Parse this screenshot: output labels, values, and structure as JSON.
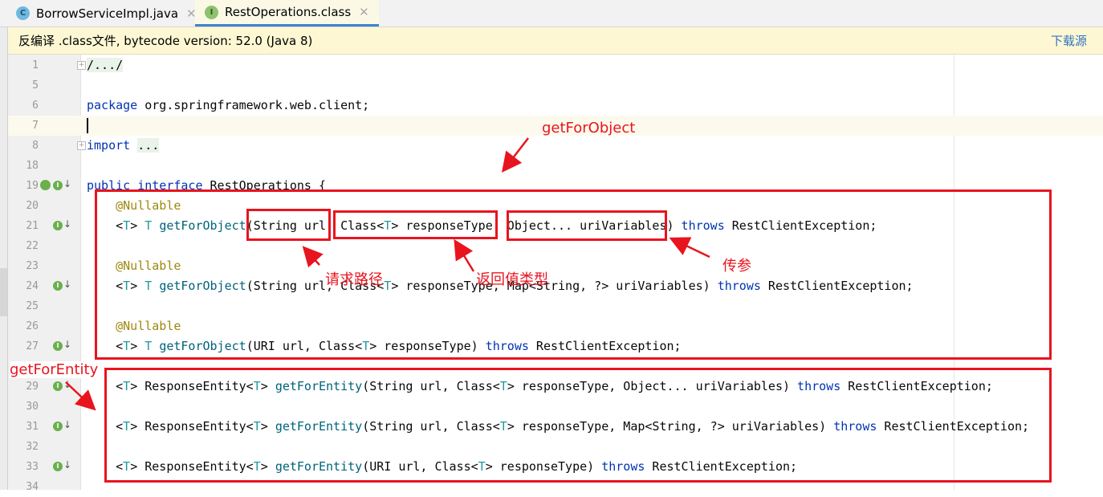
{
  "tabs": [
    {
      "label": "BorrowServiceImpl.java",
      "icon": "class-icon",
      "active": false
    },
    {
      "label": "RestOperations.class",
      "icon": "interface-icon",
      "active": true
    }
  ],
  "banner": {
    "message": "反编译 .class文件, bytecode version: 52.0 (Java 8)",
    "link": "下载源"
  },
  "lines": [
    {
      "n": "1",
      "text": "/.../",
      "fold": true,
      "folded": true
    },
    {
      "n": "5",
      "text": ""
    },
    {
      "n": "6",
      "text": "package org.springframework.web.client;"
    },
    {
      "n": "7",
      "text": "",
      "current": true
    },
    {
      "n": "8",
      "text": "import ...",
      "fold": true,
      "folded": true
    },
    {
      "n": "18",
      "text": ""
    },
    {
      "n": "19",
      "text": "public interface RestOperations {",
      "marker": "spring-interface"
    },
    {
      "n": "20",
      "text": "    @Nullable"
    },
    {
      "n": "21",
      "text": "    <T> T getForObject(String url, Class<T> responseType, Object... uriVariables) throws RestClientException;",
      "marker": "implemented"
    },
    {
      "n": "22",
      "text": ""
    },
    {
      "n": "23",
      "text": "    @Nullable"
    },
    {
      "n": "24",
      "text": "    <T> T getForObject(String url, Class<T> responseType, Map<String, ?> uriVariables) throws RestClientException;",
      "marker": "implemented"
    },
    {
      "n": "25",
      "text": ""
    },
    {
      "n": "26",
      "text": "    @Nullable"
    },
    {
      "n": "27",
      "text": "    <T> T getForObject(URI url, Class<T> responseType) throws RestClientException;",
      "marker": "implemented"
    },
    {
      "n": "",
      "text": ""
    },
    {
      "n": "29",
      "text": "    <T> ResponseEntity<T> getForEntity(String url, Class<T> responseType, Object... uriVariables) throws RestClientException;",
      "marker": "implemented"
    },
    {
      "n": "30",
      "text": ""
    },
    {
      "n": "31",
      "text": "    <T> ResponseEntity<T> getForEntity(String url, Class<T> responseType, Map<String, ?> uriVariables) throws RestClientException;",
      "marker": "implemented"
    },
    {
      "n": "32",
      "text": ""
    },
    {
      "n": "33",
      "text": "    <T> ResponseEntity<T> getForEntity(URI url, Class<T> responseType) throws RestClientException;",
      "marker": "implemented"
    },
    {
      "n": "34",
      "text": ""
    }
  ],
  "annotations": {
    "get_for_object": "getForObject",
    "request_path": "请求路径",
    "return_type": "返回值类型",
    "params": "传参",
    "get_for_entity": "getForEntity"
  },
  "colors": {
    "annotation_red": "#e8141e",
    "keyword": "#0033b3",
    "method": "#00627a",
    "annotation": "#9e880d",
    "type_param": "#20999d",
    "link": "#3574c4"
  }
}
